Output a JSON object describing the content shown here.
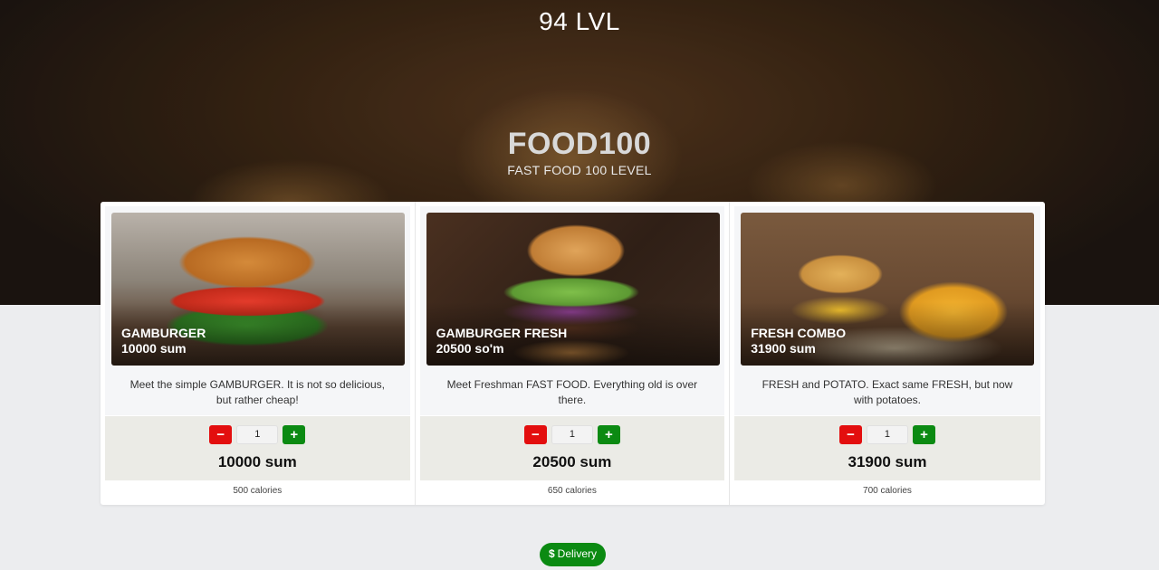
{
  "header": {
    "level_title": "94 LVL",
    "brand": "FOOD100",
    "subtitle": "FAST FOOD 100 LEVEL"
  },
  "products": [
    {
      "name": "GAMBURGER",
      "image_price": "10000 sum",
      "description": "Meet the simple GAMBURGER. It is not so delicious, but rather cheap!",
      "quantity": "1",
      "minus_label": "−",
      "plus_label": "+",
      "price": "10000 sum",
      "calories": "500 calories"
    },
    {
      "name": "GAMBURGER FRESH",
      "image_price": "20500 so'm",
      "description": "Meet Freshman FAST FOOD. Everything old is over there.",
      "quantity": "1",
      "minus_label": "−",
      "plus_label": "+",
      "price": "20500 sum",
      "calories": "650 calories"
    },
    {
      "name": "FRESH COMBO",
      "image_price": "31900 sum",
      "description": "FRESH and POTATO. Exact same FRESH, but now with potatoes.",
      "quantity": "1",
      "minus_label": "−",
      "plus_label": "+",
      "price": "31900 sum",
      "calories": "700 calories"
    }
  ],
  "delivery": {
    "icon": "dollar-icon",
    "icon_glyph": "$",
    "label": "Delivery"
  },
  "colors": {
    "minus": "#e30e0e",
    "plus": "#0b8a12",
    "delivery": "#0b8a12"
  }
}
